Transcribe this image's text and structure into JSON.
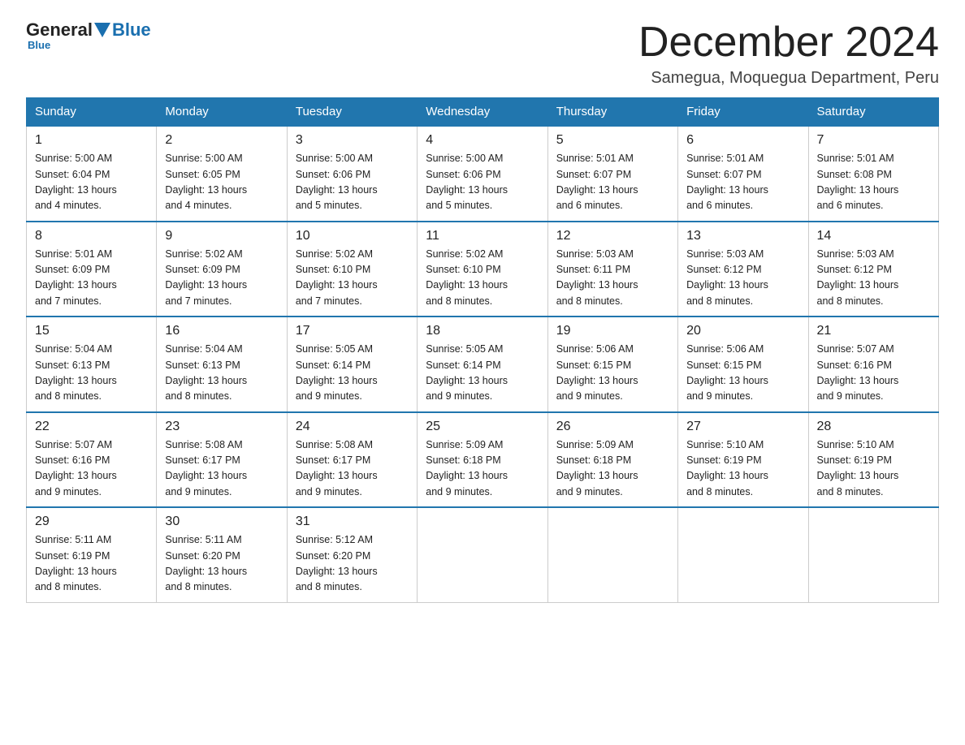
{
  "header": {
    "logo_general": "General",
    "logo_blue": "Blue",
    "month_title": "December 2024",
    "location": "Samegua, Moquegua Department, Peru"
  },
  "days_of_week": [
    "Sunday",
    "Monday",
    "Tuesday",
    "Wednesday",
    "Thursday",
    "Friday",
    "Saturday"
  ],
  "weeks": [
    [
      {
        "day": "1",
        "sunrise": "5:00 AM",
        "sunset": "6:04 PM",
        "daylight": "13 hours and 4 minutes."
      },
      {
        "day": "2",
        "sunrise": "5:00 AM",
        "sunset": "6:05 PM",
        "daylight": "13 hours and 4 minutes."
      },
      {
        "day": "3",
        "sunrise": "5:00 AM",
        "sunset": "6:06 PM",
        "daylight": "13 hours and 5 minutes."
      },
      {
        "day": "4",
        "sunrise": "5:00 AM",
        "sunset": "6:06 PM",
        "daylight": "13 hours and 5 minutes."
      },
      {
        "day": "5",
        "sunrise": "5:01 AM",
        "sunset": "6:07 PM",
        "daylight": "13 hours and 6 minutes."
      },
      {
        "day": "6",
        "sunrise": "5:01 AM",
        "sunset": "6:07 PM",
        "daylight": "13 hours and 6 minutes."
      },
      {
        "day": "7",
        "sunrise": "5:01 AM",
        "sunset": "6:08 PM",
        "daylight": "13 hours and 6 minutes."
      }
    ],
    [
      {
        "day": "8",
        "sunrise": "5:01 AM",
        "sunset": "6:09 PM",
        "daylight": "13 hours and 7 minutes."
      },
      {
        "day": "9",
        "sunrise": "5:02 AM",
        "sunset": "6:09 PM",
        "daylight": "13 hours and 7 minutes."
      },
      {
        "day": "10",
        "sunrise": "5:02 AM",
        "sunset": "6:10 PM",
        "daylight": "13 hours and 7 minutes."
      },
      {
        "day": "11",
        "sunrise": "5:02 AM",
        "sunset": "6:10 PM",
        "daylight": "13 hours and 8 minutes."
      },
      {
        "day": "12",
        "sunrise": "5:03 AM",
        "sunset": "6:11 PM",
        "daylight": "13 hours and 8 minutes."
      },
      {
        "day": "13",
        "sunrise": "5:03 AM",
        "sunset": "6:12 PM",
        "daylight": "13 hours and 8 minutes."
      },
      {
        "day": "14",
        "sunrise": "5:03 AM",
        "sunset": "6:12 PM",
        "daylight": "13 hours and 8 minutes."
      }
    ],
    [
      {
        "day": "15",
        "sunrise": "5:04 AM",
        "sunset": "6:13 PM",
        "daylight": "13 hours and 8 minutes."
      },
      {
        "day": "16",
        "sunrise": "5:04 AM",
        "sunset": "6:13 PM",
        "daylight": "13 hours and 8 minutes."
      },
      {
        "day": "17",
        "sunrise": "5:05 AM",
        "sunset": "6:14 PM",
        "daylight": "13 hours and 9 minutes."
      },
      {
        "day": "18",
        "sunrise": "5:05 AM",
        "sunset": "6:14 PM",
        "daylight": "13 hours and 9 minutes."
      },
      {
        "day": "19",
        "sunrise": "5:06 AM",
        "sunset": "6:15 PM",
        "daylight": "13 hours and 9 minutes."
      },
      {
        "day": "20",
        "sunrise": "5:06 AM",
        "sunset": "6:15 PM",
        "daylight": "13 hours and 9 minutes."
      },
      {
        "day": "21",
        "sunrise": "5:07 AM",
        "sunset": "6:16 PM",
        "daylight": "13 hours and 9 minutes."
      }
    ],
    [
      {
        "day": "22",
        "sunrise": "5:07 AM",
        "sunset": "6:16 PM",
        "daylight": "13 hours and 9 minutes."
      },
      {
        "day": "23",
        "sunrise": "5:08 AM",
        "sunset": "6:17 PM",
        "daylight": "13 hours and 9 minutes."
      },
      {
        "day": "24",
        "sunrise": "5:08 AM",
        "sunset": "6:17 PM",
        "daylight": "13 hours and 9 minutes."
      },
      {
        "day": "25",
        "sunrise": "5:09 AM",
        "sunset": "6:18 PM",
        "daylight": "13 hours and 9 minutes."
      },
      {
        "day": "26",
        "sunrise": "5:09 AM",
        "sunset": "6:18 PM",
        "daylight": "13 hours and 9 minutes."
      },
      {
        "day": "27",
        "sunrise": "5:10 AM",
        "sunset": "6:19 PM",
        "daylight": "13 hours and 8 minutes."
      },
      {
        "day": "28",
        "sunrise": "5:10 AM",
        "sunset": "6:19 PM",
        "daylight": "13 hours and 8 minutes."
      }
    ],
    [
      {
        "day": "29",
        "sunrise": "5:11 AM",
        "sunset": "6:19 PM",
        "daylight": "13 hours and 8 minutes."
      },
      {
        "day": "30",
        "sunrise": "5:11 AM",
        "sunset": "6:20 PM",
        "daylight": "13 hours and 8 minutes."
      },
      {
        "day": "31",
        "sunrise": "5:12 AM",
        "sunset": "6:20 PM",
        "daylight": "13 hours and 8 minutes."
      },
      null,
      null,
      null,
      null
    ]
  ],
  "labels": {
    "sunrise": "Sunrise:",
    "sunset": "Sunset:",
    "daylight": "Daylight:"
  }
}
